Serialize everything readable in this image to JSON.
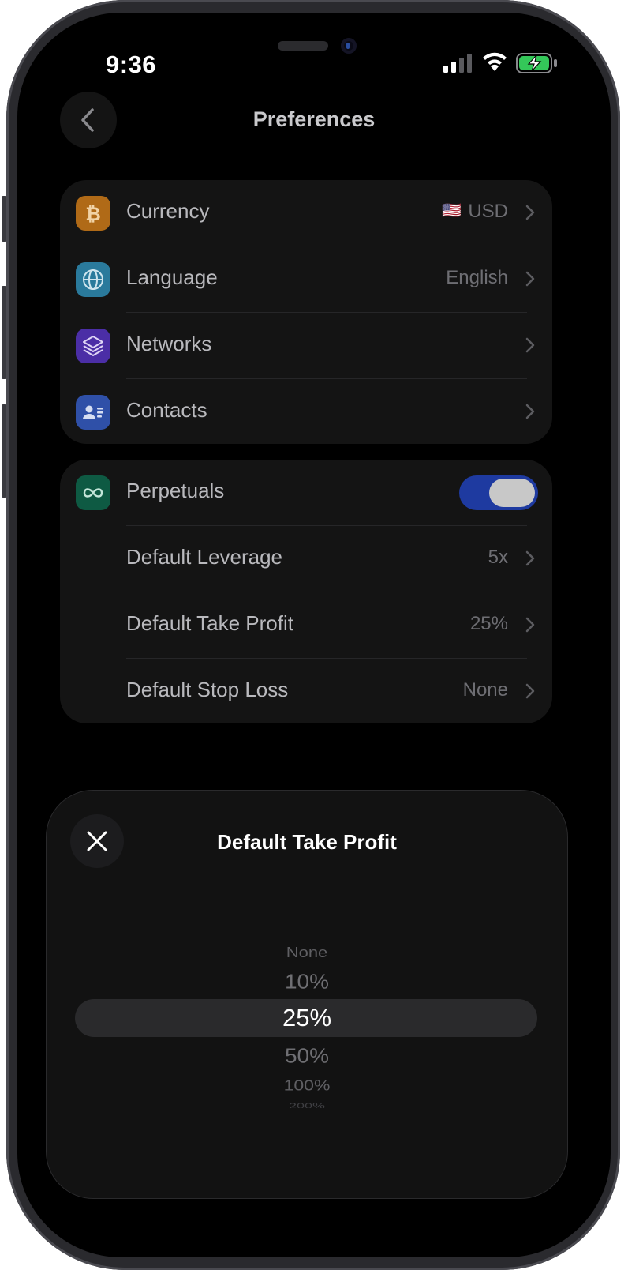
{
  "status": {
    "time": "9:36"
  },
  "nav": {
    "title": "Preferences"
  },
  "general": {
    "items": [
      {
        "label": "Currency",
        "value": "USD",
        "flag": "🇺🇸",
        "icon": "bitcoin-icon",
        "color": "#B06A17"
      },
      {
        "label": "Language",
        "value": "English",
        "icon": "globe-icon",
        "color": "#2A7A9C"
      },
      {
        "label": "Networks",
        "value": "",
        "icon": "layers-icon",
        "color": "#4B2EA6"
      },
      {
        "label": "Contacts",
        "value": "",
        "icon": "contact-card-icon",
        "color": "#2F50A8"
      }
    ]
  },
  "perps": {
    "toggle_label": "Perpetuals",
    "toggle_on": true,
    "toggle_color": "#1E3AA0",
    "icon_color": "#0E5A43",
    "items": [
      {
        "label": "Default Leverage",
        "value": "5x"
      },
      {
        "label": "Default Take Profit",
        "value": "25%"
      },
      {
        "label": "Default Stop Loss",
        "value": "None"
      }
    ]
  },
  "sheet": {
    "title": "Default Take Profit",
    "options": [
      "None",
      "10%",
      "25%",
      "50%",
      "100%",
      "200%"
    ],
    "selected": "25%"
  }
}
